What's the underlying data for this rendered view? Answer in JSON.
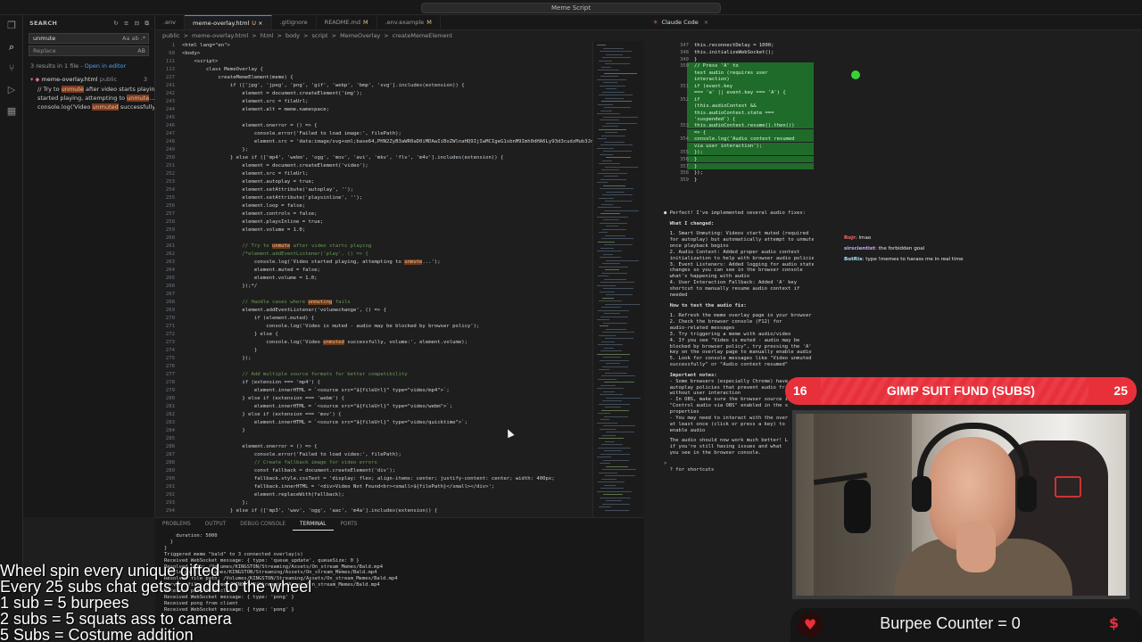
{
  "window": {
    "title_search": "Meme Script"
  },
  "activity_icons": [
    "files-icon",
    "search-icon",
    "source-control-icon",
    "run-debug-icon",
    "extensions-icon"
  ],
  "sidebar": {
    "title": "SEARCH",
    "search_value": "unmute",
    "replace_placeholder": "Replace",
    "search_options": "Aa ab .*",
    "replace_opt": "AB",
    "results_summary": "3 results in 1 file",
    "open_in_editor": "Open in editor",
    "file": {
      "name": "meme-overlay.html",
      "path": "public",
      "badge": "3"
    },
    "results": [
      {
        "pre": "// Try to ",
        "hit": "unmute",
        "post": " after video starts playing"
      },
      {
        "pre": "started playing, attempting to ",
        "hit": "unmute",
        "post": "..."
      },
      {
        "pre": "console.log('Video ",
        "hit": "unmuted",
        "post": " successfully..."
      }
    ]
  },
  "tabs": [
    {
      "label": ".env",
      "mod": ""
    },
    {
      "label": "meme-overlay.html",
      "mod": "U",
      "active": true
    },
    {
      "label": ".gitignore",
      "mod": ""
    },
    {
      "label": "README.md",
      "mod": "M"
    },
    {
      "label": ".env.example",
      "mod": "M"
    }
  ],
  "breadcrumb": [
    "public",
    ">",
    "meme-overlay.html",
    ">",
    "html",
    ">",
    "body",
    ">",
    "script",
    ">",
    "MemeOverlay",
    ">",
    "createMemeElement"
  ],
  "code_lines": [
    {
      "n": "1",
      "t": "<html lang=\"en\">"
    },
    {
      "n": "60",
      "t": "<body>"
    },
    {
      "n": "111",
      "t": "    <script>"
    },
    {
      "n": "113",
      "t": "        class MemeOverlay {"
    },
    {
      "n": "227",
      "t": "            createMemeElement(meme) {"
    },
    {
      "n": "241",
      "t": "                if (['jpg', 'jpeg', 'png', 'gif', 'webp', 'bmp', 'svg'].includes(extension)) {"
    },
    {
      "n": "242",
      "t": "                    element = document.createElement('img');"
    },
    {
      "n": "243",
      "t": "                    element.src = fileUrl;"
    },
    {
      "n": "244",
      "t": "                    element.alt = meme.namespace;"
    },
    {
      "n": "245",
      "t": ""
    },
    {
      "n": "246",
      "t": "                    element.onerror = () => {"
    },
    {
      "n": "247",
      "t": "                        console.error('Failed to load image:', filePath);"
    },
    {
      "n": "248",
      "t": "                        element.src = 'data:image/svg+xml;base64,PHN2ZyB3aWR0aD0iMDAwIiBoZWlnaHQ9IjIwMCIgeG1sbnM9Imh0dHA6Ly93d3cudzMub3JnLzIwMDAvc3ZnIj48cmVjdCB3aWR0aD0iMTAwJSIgaGVpZ2h0PSIxMDAlIiBmaWxsPSIjY2NjIi8+PC9zdmc+';"
    },
    {
      "n": "249",
      "t": "                    };"
    },
    {
      "n": "250",
      "t": "                } else if (['mp4', 'webm', 'ogg', 'mov', 'avi', 'mkv', 'flv', 'm4v'].includes(extension)) {"
    },
    {
      "n": "251",
      "t": "                    element = document.createElement('video');"
    },
    {
      "n": "252",
      "t": "                    element.src = fileUrl;"
    },
    {
      "n": "253",
      "t": "                    element.autoplay = true;"
    },
    {
      "n": "254",
      "t": "                    element.setAttribute('autoplay', '');"
    },
    {
      "n": "255",
      "t": "                    element.setAttribute('playsinline', '');"
    },
    {
      "n": "256",
      "t": "                    element.loop = false;"
    },
    {
      "n": "257",
      "t": "                    element.controls = false;"
    },
    {
      "n": "258",
      "t": "                    element.playsInline = true;"
    },
    {
      "n": "259",
      "t": "                    element.volume = 1.0;"
    },
    {
      "n": "260",
      "t": ""
    },
    {
      "n": "261",
      "t": "                    // Try to unmute after video starts playing"
    },
    {
      "n": "262",
      "t": "                    /*element.addEventListener('play', () => {"
    },
    {
      "n": "263",
      "t": "                        console.log('Video started playing, attempting to unmute...');"
    },
    {
      "n": "264",
      "t": "                        element.muted = false;"
    },
    {
      "n": "265",
      "t": "                        element.volume = 1.0;"
    },
    {
      "n": "266",
      "t": "                    });*/"
    },
    {
      "n": "267",
      "t": ""
    },
    {
      "n": "268",
      "t": "                    // Handle cases where unmuting fails"
    },
    {
      "n": "269",
      "t": "                    element.addEventListener('volumechange', () => {"
    },
    {
      "n": "270",
      "t": "                        if (element.muted) {"
    },
    {
      "n": "271",
      "t": "                            console.log('Video is muted - audio may be blocked by browser policy');"
    },
    {
      "n": "272",
      "t": "                        } else {"
    },
    {
      "n": "273",
      "t": "                            console.log('Video unmuted successfully, volume:', element.volume);"
    },
    {
      "n": "274",
      "t": "                        }"
    },
    {
      "n": "275",
      "t": "                    });"
    },
    {
      "n": "276",
      "t": ""
    },
    {
      "n": "277",
      "t": "                    // Add multiple source formats for better compatibility"
    },
    {
      "n": "278",
      "t": "                    if (extension === 'mp4') {"
    },
    {
      "n": "279",
      "t": "                        element.innerHTML = `<source src=\"${fileUrl}\" type=\"video/mp4\">`;"
    },
    {
      "n": "280",
      "t": "                    } else if (extension === 'webm') {"
    },
    {
      "n": "281",
      "t": "                        element.innerHTML = `<source src=\"${fileUrl}\" type=\"video/webm\">`;"
    },
    {
      "n": "282",
      "t": "                    } else if (extension === 'mov') {"
    },
    {
      "n": "283",
      "t": "                        element.innerHTML = `<source src=\"${fileUrl}\" type=\"video/quicktime\">`;"
    },
    {
      "n": "284",
      "t": "                    }"
    },
    {
      "n": "285",
      "t": ""
    },
    {
      "n": "286",
      "t": "                    element.onerror = () => {"
    },
    {
      "n": "287",
      "t": "                        console.error('Failed to load video:', filePath);"
    },
    {
      "n": "288",
      "t": "                        // Create fallback image for video errors"
    },
    {
      "n": "289",
      "t": "                        const fallback = document.createElement('div');"
    },
    {
      "n": "290",
      "t": "                        fallback.style.cssText = 'display: flex; align-items: center; justify-content: center; width: 400px;"
    },
    {
      "n": "291",
      "t": "                        fallback.innerHTML = '<div>Video Not Found<br><small>${filePath}</small></div>';"
    },
    {
      "n": "292",
      "t": "                        element.replaceWith(fallback);"
    },
    {
      "n": "293",
      "t": "                    };"
    },
    {
      "n": "294",
      "t": "                } else if (['mp3', 'wav', 'ogg', 'aac', 'm4a'].includes(extension)) {"
    }
  ],
  "panel_tabs": [
    {
      "label": "PROBLEMS"
    },
    {
      "label": "OUTPUT"
    },
    {
      "label": "DEBUG CONSOLE"
    },
    {
      "label": "TERMINAL",
      "active": true
    },
    {
      "label": "PORTS"
    }
  ],
  "terminal_lines": [
    "    duration: 5000",
    "  }",
    "}",
    "Triggered meme \"bald\" to 3 connected overlay(s)",
    "Received WebSocket message: { type: 'queue_update', queueSize: 0 }",
    "Resolved path: /Volumes/KINGSTON/Streaming/Assets/On_stream_Memes/Bald.mp4",
    "  File path: /Volumes/KINGSTON/Streaming/Assets/On_stream_Memes/Bald.mp4",
    "Resolved file path: /Volumes/KINGSTON/Streaming/Assets/On_stream_Memes/Bald.mp4",
    "Serving file: /Volumes/KINGSTON/Streaming/Assets/On_stream_Memes/Bald.mp4",
    "Received pong from client",
    "Received WebSocket message: { type: 'pong' }",
    "Received pong from client",
    "Received WebSocket message: { type: 'pong' }"
  ],
  "claude": {
    "title": "Claude Code",
    "diff_lines": [
      {
        "n": "347",
        "t": "this.reconnectDelay = 1000;",
        "g": false
      },
      {
        "n": "348",
        "t": "this.initializeWebSocket();",
        "g": false
      },
      {
        "n": "349",
        "t": "}",
        "g": false
      },
      {
        "n": "350",
        "t": "// Press 'A' to",
        "g": true
      },
      {
        "n": "",
        "t": "test audio (requires user",
        "g": true
      },
      {
        "n": "",
        "t": "interaction)",
        "g": true
      },
      {
        "n": "351",
        "t": "if (event.key",
        "g": true
      },
      {
        "n": "",
        "t": "=== 'a' || event.key === 'A') {",
        "g": true
      },
      {
        "n": "352",
        "t": "if",
        "g": true
      },
      {
        "n": "",
        "t": "(this.audioContext &&",
        "g": true
      },
      {
        "n": "",
        "t": "this.audioContext.state ===",
        "g": true
      },
      {
        "n": "",
        "t": "'suspended') {",
        "g": true
      },
      {
        "n": "353",
        "t": "this.audioContext.resume().then(()",
        "g": true
      },
      {
        "n": "",
        "t": "=> {",
        "g": true
      },
      {
        "n": "354",
        "t": "console.log('Audio context resumed",
        "g": true
      },
      {
        "n": "",
        "t": "via user interaction');",
        "g": true
      },
      {
        "n": "355",
        "t": "});",
        "g": true
      },
      {
        "n": "356",
        "t": "}",
        "g": true
      },
      {
        "n": "357",
        "t": "}",
        "g": true
      },
      {
        "n": "358",
        "t": "});",
        "g": false
      },
      {
        "n": "359",
        "t": "}",
        "g": false
      }
    ],
    "summary_lines": [
      "● Perfect! I've implemented several audio fixes:",
      "",
      "  What I changed:",
      "",
      "  1. Smart Unmuting: Videos start muted (required",
      "  for autoplay) but automatically attempt to unmute",
      "  once playback begins",
      "  2. Audio Context: Added proper audio context",
      "  initialization to help with browser audio policies",
      "  3. Event Listeners: Added logging for audio state",
      "  changes so you can see in the browser console",
      "  what's happening with audio",
      "  4. User Interaction Fallback: Added 'A' key",
      "  shortcut to manually resume audio context if",
      "  needed",
      "",
      "  How to test the audio fix:",
      "",
      "  1. Refresh the meme overlay page in your browser",
      "  2. Check the browser console (F12) for",
      "  audio-related messages",
      "  3. Try triggering a meme with audio/video",
      "  4. If you see \"Video is muted - audio may be",
      "  blocked by browser policy\", try pressing the 'A'",
      "  key on the overlay page to manually enable audio",
      "  5. Look for console messages like \"Video unmuted",
      "  successfully\" or \"Audio context resumed\"",
      "",
      "  Important notes:",
      "  - Some browsers (especially Chrome) have",
      "  autoplay policies that prevent audio fr",
      "  without user interaction",
      "  - In OBS, make sure the browser source i",
      "  \"Control audio via OBS\" enabled in the s",
      "  properties",
      "  - You may need to interact with the over",
      "  at least once (click or press a key) to",
      "  enable audio",
      "",
      "  The audio should now work much better! L",
      "  if you're still having issues and what",
      "  you see in the browser console.",
      "",
      ">",
      "  ? for shortcuts"
    ]
  },
  "chat": [
    {
      "user": "Rojr",
      "msg": ": lmao",
      "color": "#ff6b6b"
    },
    {
      "user": "sirscientist",
      "msg": ": the forbidden goal",
      "color": "#c7a6ff"
    },
    {
      "user": "BotRix",
      "msg": ": type !memes to harass me in real time",
      "color": "#a6e3ff"
    }
  ],
  "sub_goal": {
    "current": "16",
    "title": "GIMP SUIT FUND (SUBS)",
    "target": "25"
  },
  "burpee": {
    "label": "Burpee Counter = 0"
  },
  "overlay_text": [
    "Wheel spin every unique gifted",
    "Every 25 subs chat gets to add to the wheel",
    "1 sub = 5 burpees",
    "2 subs = 5 squats ass to camera",
    "5 Subs = Costume addition"
  ]
}
